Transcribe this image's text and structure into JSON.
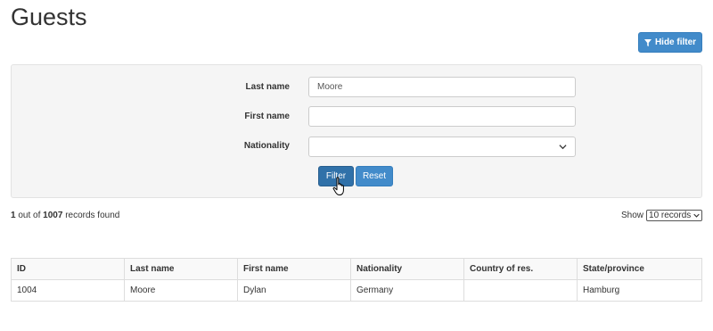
{
  "page": {
    "title": "Guests"
  },
  "toolbar": {
    "hide_filter_label": "Hide filter"
  },
  "filter": {
    "last_name_label": "Last name",
    "last_name_value": "Moore",
    "first_name_label": "First name",
    "first_name_value": "",
    "nationality_label": "Nationality",
    "nationality_value": "",
    "filter_button": "Filter",
    "reset_button": "Reset"
  },
  "results": {
    "count": "1",
    "out_of_text": "out of",
    "total": "1007",
    "suffix_text": "records found",
    "show_label": "Show",
    "page_size": "10 records"
  },
  "table": {
    "headers": [
      "ID",
      "Last name",
      "First name",
      "Nationality",
      "Country of res.",
      "State/province"
    ],
    "rows": [
      [
        "1004",
        "Moore",
        "Dylan",
        "Germany",
        "",
        "Hamburg"
      ]
    ]
  },
  "colors": {
    "primary": "#428bca",
    "primary_active": "#3071a9",
    "panel_bg": "#f5f5f5"
  },
  "icons": {
    "hide_filter": "filter-icon",
    "select": "chevron-down-icon",
    "cursor": "hand-pointer-icon"
  }
}
